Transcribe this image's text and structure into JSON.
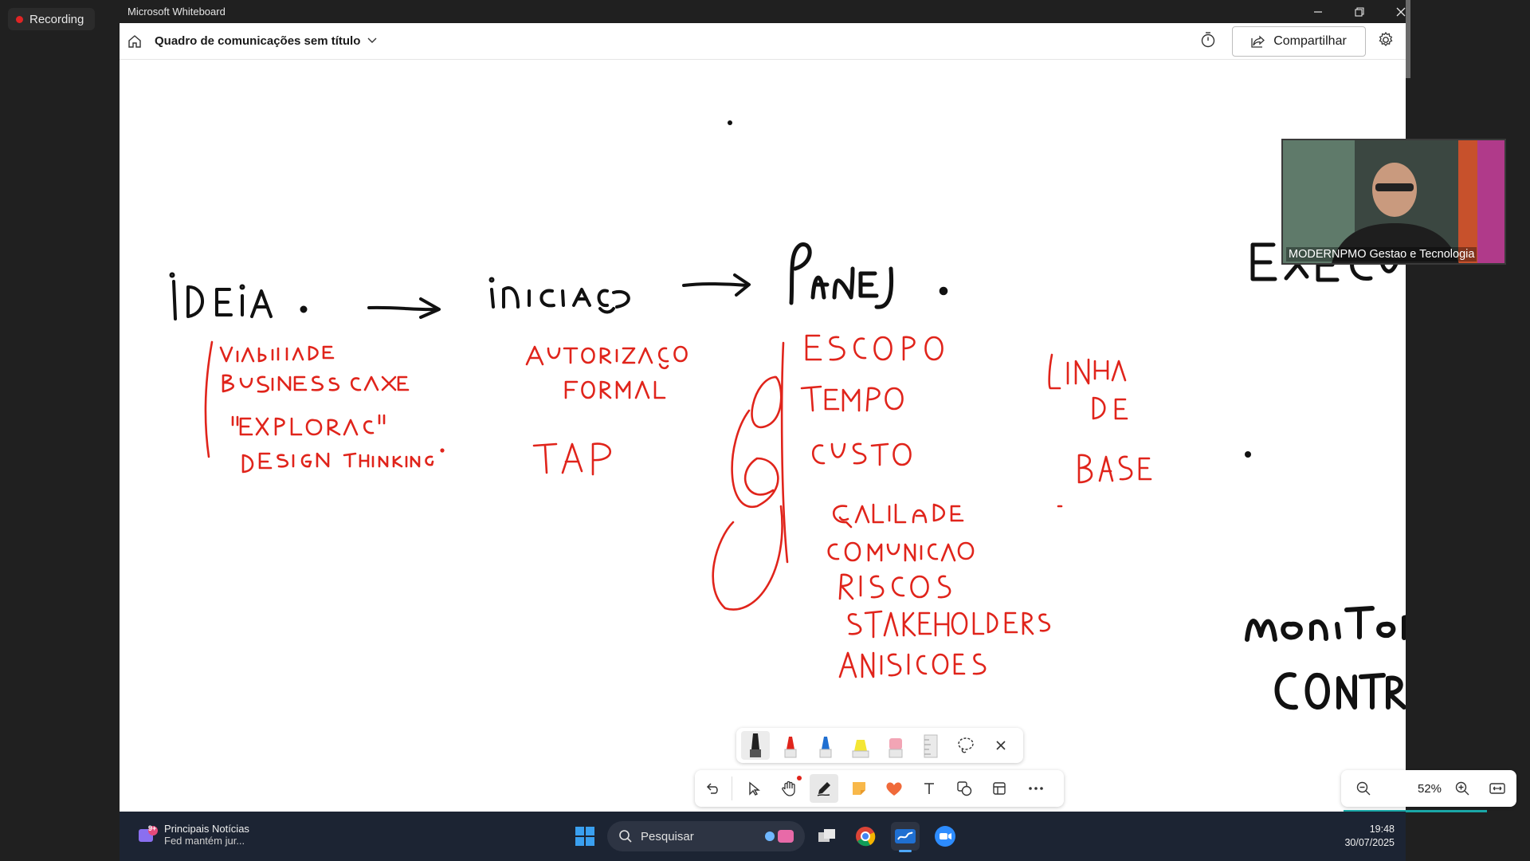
{
  "recording": {
    "label": "Recording"
  },
  "window": {
    "title": "Microsoft Whiteboard",
    "board_title": "Quadro de comunicações sem título",
    "share_label": "Compartilhar"
  },
  "video": {
    "participant_name": "MODERNPMO Gestao e Tecnologia"
  },
  "zoom": {
    "level": "52%"
  },
  "taskbar": {
    "news_title": "Principais Notícias",
    "news_subtitle": "Fed mantém jur...",
    "news_badge": "9+",
    "search_placeholder": "Pesquisar",
    "time": "19:48",
    "date": "30/07/2025"
  },
  "ink_colors": {
    "black": "#111111",
    "red": "#e0241b"
  },
  "pen_tray": [
    "black-pen",
    "red-pen",
    "blue-pen",
    "yellow-highlighter",
    "eraser",
    "ruler",
    "lasso",
    "close"
  ],
  "toolbar": [
    "undo",
    "select",
    "pan",
    "ink",
    "sticky-note",
    "reactions",
    "text",
    "shapes",
    "templates",
    "more"
  ]
}
